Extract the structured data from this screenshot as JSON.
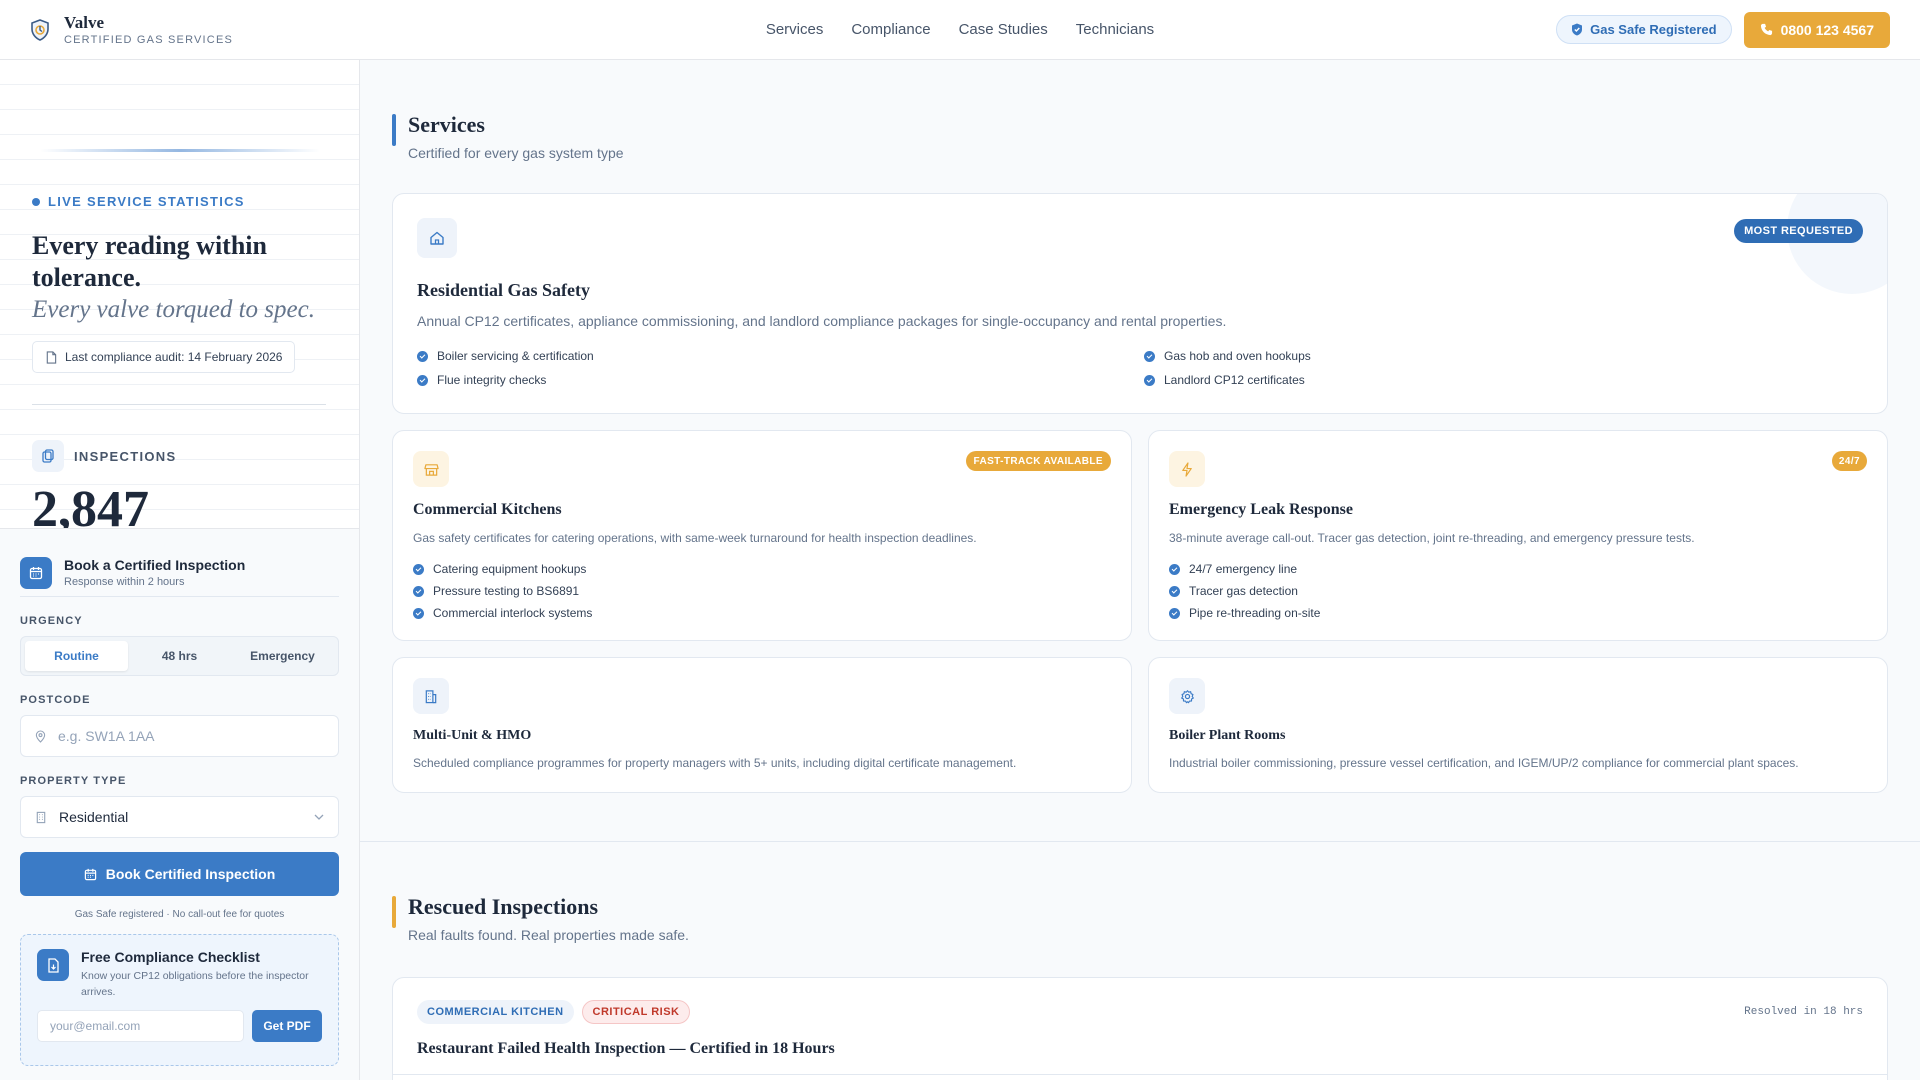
{
  "header": {
    "brand_name": "Valve",
    "brand_sub": "CERTIFIED GAS SERVICES",
    "nav": [
      "Services",
      "Compliance",
      "Case Studies",
      "Technicians"
    ],
    "badge": "Gas Safe Registered",
    "phone": "0800 123 4567"
  },
  "sidebar": {
    "live_label": "LIVE SERVICE STATISTICS",
    "hero_title": "Every reading within tolerance.",
    "hero_italic": "Every valve torqued to spec.",
    "audit": "Last compliance audit: 14 February 2026",
    "inspections_label": "INSPECTIONS",
    "inspections_value": "2,847"
  },
  "booking": {
    "title": "Book a Certified Inspection",
    "subtitle": "Response within 2 hours",
    "urgency_label": "URGENCY",
    "urgency_options": [
      "Routine",
      "48 hrs",
      "Emergency"
    ],
    "urgency_selected": "Routine",
    "postcode_label": "POSTCODE",
    "postcode_placeholder": "e.g. SW1A 1AA",
    "postcode_value": "",
    "property_label": "PROPERTY TYPE",
    "property_value": "Residential",
    "cta": "Book Certified Inspection",
    "fine_print": "Gas Safe registered · No call-out fee for quotes"
  },
  "checklist": {
    "title": "Free Compliance Checklist",
    "subtitle": "Know your CP12 obligations before the inspector arrives.",
    "email_placeholder": "your@email.com",
    "button": "Get PDF"
  },
  "services": {
    "title": "Services",
    "subtitle": "Certified for every gas system type",
    "cards": [
      {
        "title": "Residential Gas Safety",
        "badge": "MOST REQUESTED",
        "desc": "Annual CP12 certificates, appliance commissioning, and landlord compliance packages for single-occupancy and rental properties.",
        "features": [
          "Boiler servicing & certification",
          "Flue integrity checks",
          "Gas hob and oven hookups",
          "Landlord CP12 certificates"
        ],
        "icon": "home-icon"
      },
      {
        "title": "Commercial Kitchens",
        "badge": "FAST-TRACK AVAILABLE",
        "desc": "Gas safety certificates for catering operations, with same-week turnaround for health inspection deadlines.",
        "features": [
          "Catering equipment hookups",
          "Pressure testing to BS6891",
          "Commercial interlock systems"
        ],
        "icon": "store-icon"
      },
      {
        "title": "Emergency Leak Response",
        "badge": "24/7",
        "desc": "38-minute average call-out. Tracer gas detection, joint re-threading, and emergency pressure tests.",
        "features": [
          "24/7 emergency line",
          "Tracer gas detection",
          "Pipe re-threading on-site"
        ],
        "icon": "lightning-icon"
      },
      {
        "title": "Multi-Unit & HMO",
        "desc": "Scheduled compliance programmes for property managers with 5+ units, including digital certificate management.",
        "icon": "building-icon"
      },
      {
        "title": "Boiler Plant Rooms",
        "desc": "Industrial boiler commissioning, pressure vessel certification, and IGEM/UP/2 compliance for commercial plant spaces.",
        "icon": "gear-icon"
      }
    ]
  },
  "rescued": {
    "title": "Rescued Inspections",
    "subtitle": "Real faults found. Real properties made safe.",
    "case": {
      "tags": [
        "COMMERCIAL KITCHEN",
        "CRITICAL RISK"
      ],
      "resolved": "Resolved in 18 hrs",
      "title": "Restaurant Failed Health Inspection — Certified in 18 Hours"
    }
  },
  "colors": {
    "accent": "#3b7bc6",
    "amber": "#e8a93a",
    "critical": "#c0392b"
  }
}
